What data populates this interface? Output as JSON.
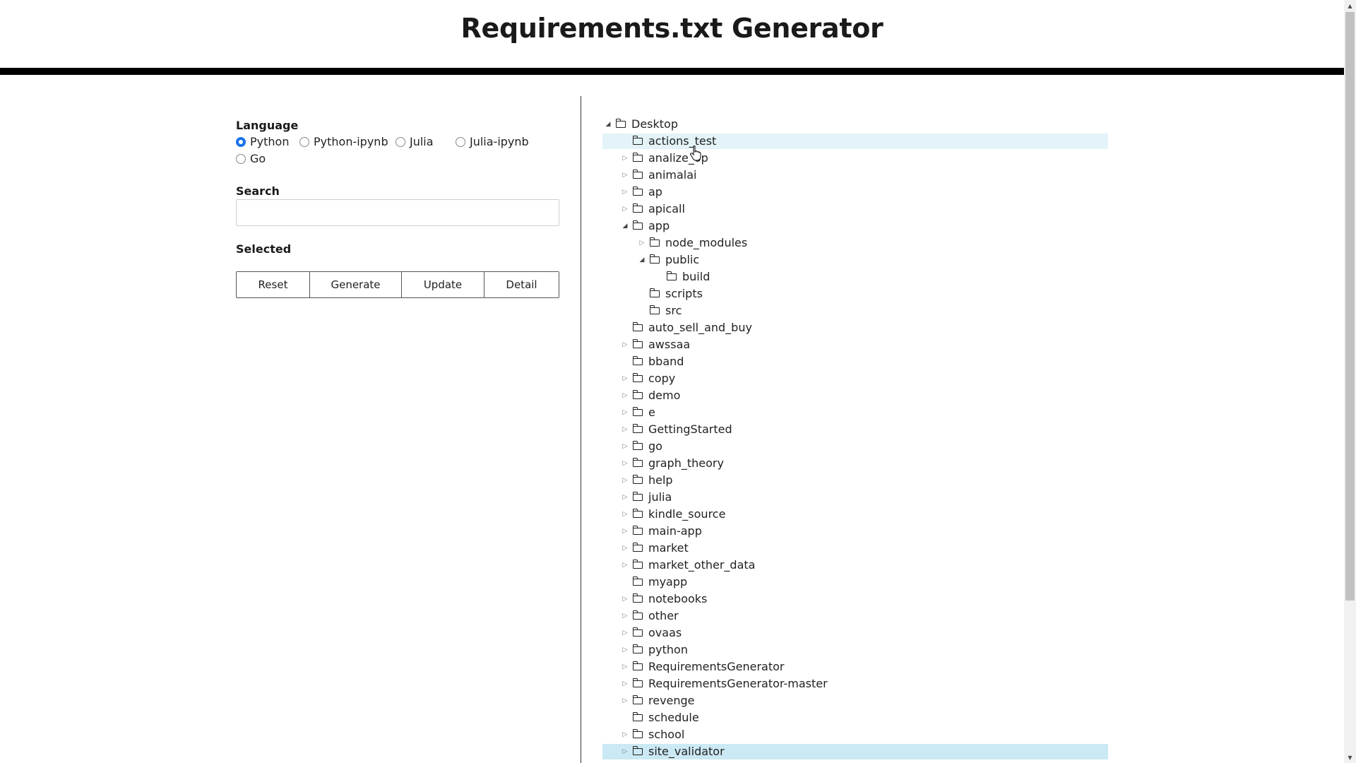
{
  "header": {
    "title": "Requirements.txt Generator"
  },
  "form": {
    "language_label": "Language",
    "languages": [
      {
        "label": "Python",
        "checked": true
      },
      {
        "label": "Python-ipynb",
        "checked": false
      },
      {
        "label": "Julia",
        "checked": false
      },
      {
        "label": "Julia-ipynb",
        "checked": false
      },
      {
        "label": "Go",
        "checked": false
      }
    ],
    "search_label": "Search",
    "search_value": "",
    "search_placeholder": "",
    "selected_label": "Selected",
    "buttons": [
      "Reset",
      "Generate",
      "Update",
      "Detail"
    ]
  },
  "tree": {
    "nodes": [
      {
        "label": "Desktop",
        "depth": 0,
        "toggle": "expanded"
      },
      {
        "label": "actions_test",
        "depth": 1,
        "toggle": "none",
        "highlight": "hover"
      },
      {
        "label": "analize_op",
        "depth": 1,
        "toggle": "collapsed"
      },
      {
        "label": "animalai",
        "depth": 1,
        "toggle": "collapsed"
      },
      {
        "label": "ap",
        "depth": 1,
        "toggle": "collapsed"
      },
      {
        "label": "apicall",
        "depth": 1,
        "toggle": "collapsed"
      },
      {
        "label": "app",
        "depth": 1,
        "toggle": "expanded"
      },
      {
        "label": "node_modules",
        "depth": 2,
        "toggle": "collapsed"
      },
      {
        "label": "public",
        "depth": 2,
        "toggle": "expanded"
      },
      {
        "label": "build",
        "depth": 3,
        "toggle": "none"
      },
      {
        "label": "scripts",
        "depth": 2,
        "toggle": "none"
      },
      {
        "label": "src",
        "depth": 2,
        "toggle": "none"
      },
      {
        "label": "auto_sell_and_buy",
        "depth": 1,
        "toggle": "none"
      },
      {
        "label": "awssaa",
        "depth": 1,
        "toggle": "collapsed"
      },
      {
        "label": "bband",
        "depth": 1,
        "toggle": "none"
      },
      {
        "label": "copy",
        "depth": 1,
        "toggle": "collapsed"
      },
      {
        "label": "demo",
        "depth": 1,
        "toggle": "collapsed"
      },
      {
        "label": "e",
        "depth": 1,
        "toggle": "collapsed"
      },
      {
        "label": "GettingStarted",
        "depth": 1,
        "toggle": "collapsed"
      },
      {
        "label": "go",
        "depth": 1,
        "toggle": "collapsed"
      },
      {
        "label": "graph_theory",
        "depth": 1,
        "toggle": "collapsed"
      },
      {
        "label": "help",
        "depth": 1,
        "toggle": "collapsed"
      },
      {
        "label": "julia",
        "depth": 1,
        "toggle": "collapsed"
      },
      {
        "label": "kindle_source",
        "depth": 1,
        "toggle": "collapsed"
      },
      {
        "label": "main-app",
        "depth": 1,
        "toggle": "collapsed"
      },
      {
        "label": "market",
        "depth": 1,
        "toggle": "collapsed"
      },
      {
        "label": "market_other_data",
        "depth": 1,
        "toggle": "collapsed"
      },
      {
        "label": "myapp",
        "depth": 1,
        "toggle": "none"
      },
      {
        "label": "notebooks",
        "depth": 1,
        "toggle": "collapsed"
      },
      {
        "label": "other",
        "depth": 1,
        "toggle": "collapsed"
      },
      {
        "label": "ovaas",
        "depth": 1,
        "toggle": "collapsed"
      },
      {
        "label": "python",
        "depth": 1,
        "toggle": "collapsed"
      },
      {
        "label": "RequirementsGenerator",
        "depth": 1,
        "toggle": "collapsed"
      },
      {
        "label": "RequirementsGenerator-master",
        "depth": 1,
        "toggle": "collapsed"
      },
      {
        "label": "revenge",
        "depth": 1,
        "toggle": "collapsed"
      },
      {
        "label": "schedule",
        "depth": 1,
        "toggle": "none"
      },
      {
        "label": "school",
        "depth": 1,
        "toggle": "collapsed"
      },
      {
        "label": "site_validator",
        "depth": 1,
        "toggle": "collapsed",
        "highlight": "selected"
      }
    ]
  },
  "colors": {
    "radio_accent": "#1a73e8",
    "row_hover": "#e3f3f8",
    "row_selected": "#cbe9f4",
    "header_bar": "#000000"
  },
  "icons": {
    "folder": "folder-icon",
    "collapsed": "caret-right-icon",
    "expanded": "caret-down-icon",
    "cursor": "pointer-cursor-icon"
  }
}
